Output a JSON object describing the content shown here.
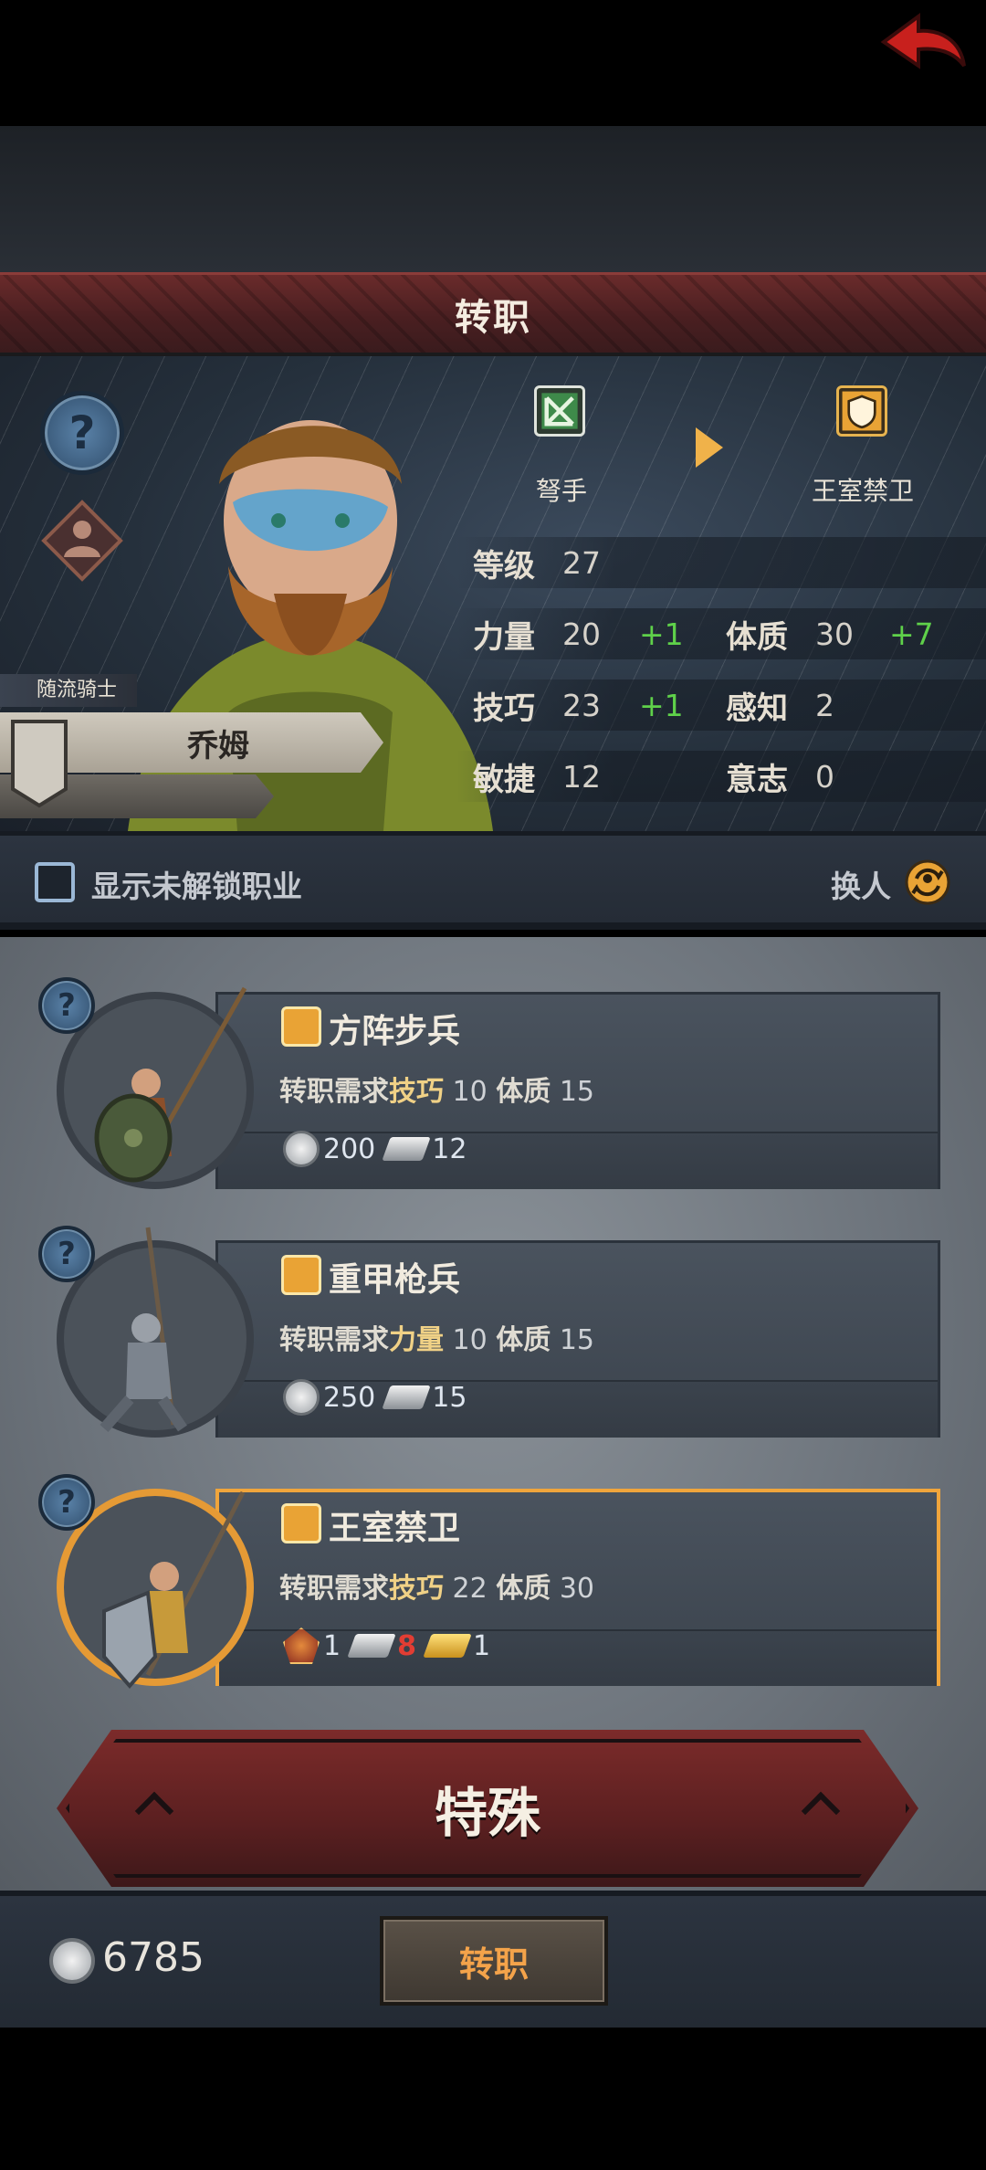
{
  "header": {
    "title": "转职"
  },
  "hero": {
    "class_label": "随流骑士",
    "name": "乔姆",
    "from_class": "弩手",
    "to_class": "王室禁卫",
    "stats": {
      "level_label": "等级",
      "level": "27",
      "str_label": "力量",
      "str": "20",
      "str_plus": "+1",
      "con_label": "体质",
      "con": "30",
      "con_plus": "+7",
      "skill_label": "技巧",
      "skill": "23",
      "skill_plus": "+1",
      "per_label": "感知",
      "per": "2",
      "agi_label": "敏捷",
      "agi": "12",
      "will_label": "意志",
      "will": "0"
    }
  },
  "filter": {
    "show_locked_label": "显示未解锁职业",
    "swap_label": "换人"
  },
  "classes": [
    {
      "name": "方阵步兵",
      "req_label": "转职需求",
      "req1_k": "技巧",
      "req1_v": "10",
      "req2_k": "体质",
      "req2_v": "15",
      "coins": "200",
      "ingots": "12"
    },
    {
      "name": "重甲枪兵",
      "req_label": "转职需求",
      "req1_k": "力量",
      "req1_v": "10",
      "req2_k": "体质",
      "req2_v": "15",
      "coins": "250",
      "ingots": "15"
    },
    {
      "name": "王室禁卫",
      "req_label": "转职需求",
      "req1_k": "技巧",
      "req1_v": "22",
      "req2_k": "体质",
      "req2_v": "30",
      "medal": "1",
      "ingots": "8",
      "gold": "1"
    }
  ],
  "special_button": "特殊",
  "footer": {
    "money": "6785",
    "convert_label": "转职"
  },
  "colors": {
    "accent": "#f0a53c",
    "plus_green": "#5fd14a",
    "title_red": "#5a1f20"
  }
}
